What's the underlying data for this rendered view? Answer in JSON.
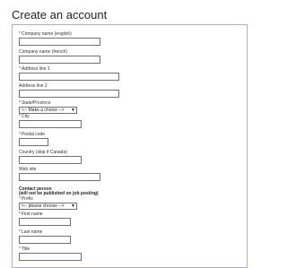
{
  "page": {
    "title": "Create an account"
  },
  "form": {
    "required_mark": "*",
    "company_name_en": {
      "label": "Company name (english)",
      "value": ""
    },
    "company_name_fr": {
      "label": "Company name (french)",
      "value": ""
    },
    "address_line1": {
      "label": "Address line 1",
      "value": ""
    },
    "address_line2": {
      "label": "Address line 2",
      "value": ""
    },
    "state": {
      "label": "State/Province",
      "selected": "<-- Make a choice -->"
    },
    "city": {
      "label": "City",
      "value": ""
    },
    "postal_code": {
      "label": "Postal code",
      "value": ""
    },
    "country": {
      "label": "Country (skip if Canada)",
      "value": ""
    },
    "web_site": {
      "label": "Web site",
      "value": ""
    },
    "contact_heading": "Contact person",
    "contact_subheading": "(will not be published on job posting)",
    "prefix": {
      "label": "Prefix",
      "selected": "<-- please choose -->"
    },
    "first_name": {
      "label": "First name",
      "value": ""
    },
    "last_name": {
      "label": "Last name",
      "value": ""
    },
    "title": {
      "label": "Title",
      "value": ""
    }
  }
}
